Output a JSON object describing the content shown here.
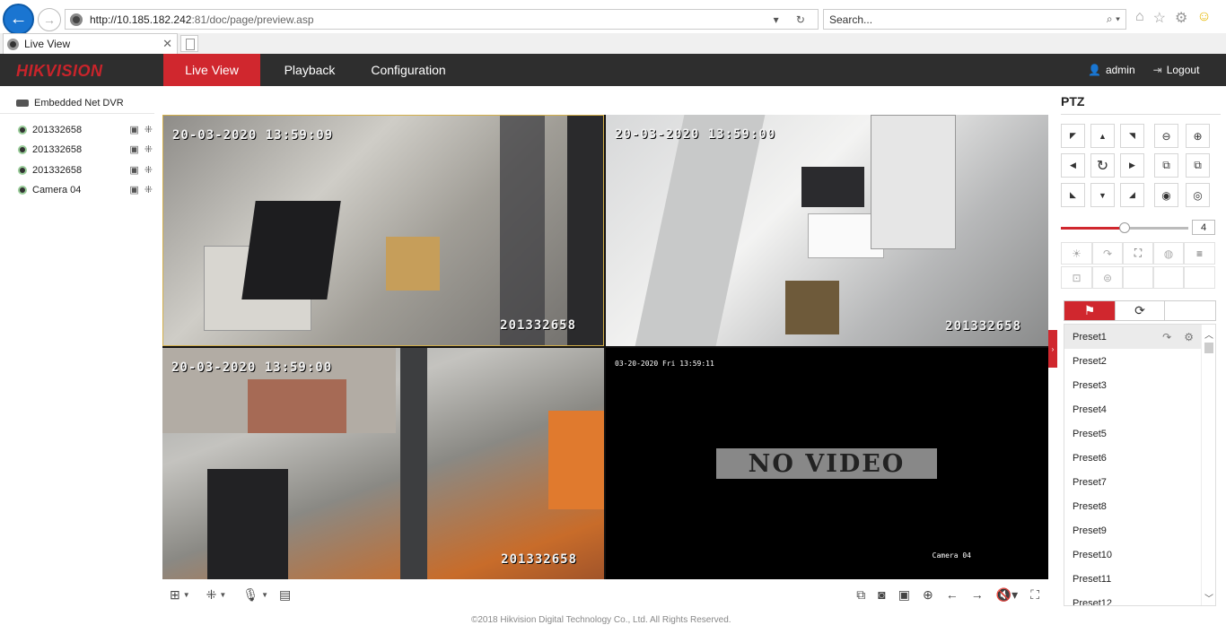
{
  "browser": {
    "url_host": "http://10.185.182.242",
    "url_path": ":81/doc/page/preview.asp",
    "search_placeholder": "Search...",
    "tab_title": "Live View"
  },
  "header": {
    "logo": "HIKVISION",
    "nav": [
      "Live View",
      "Playback",
      "Configuration"
    ],
    "user": "admin",
    "logout": "Logout"
  },
  "tree": {
    "root": "Embedded Net DVR",
    "cameras": [
      "201332658",
      "201332658",
      "201332658",
      "Camera 04"
    ]
  },
  "video": {
    "timestamps": [
      "20-03-2020 13:59:09",
      "20-03-2020 13:59:00",
      "20-03-2020 13:59:00",
      "03-20-2020 Fri 13:59:11"
    ],
    "cam_names": [
      "201332658",
      "201332658",
      "201332658",
      "Camera 04"
    ],
    "no_video": "NO VIDEO"
  },
  "footer": "©2018 Hikvision Digital Technology Co., Ltd. All Rights Reserved.",
  "ptz": {
    "title": "PTZ",
    "speed": "4",
    "speed_level": 4,
    "speed_max": 7,
    "presets": [
      "Preset1",
      "Preset2",
      "Preset3",
      "Preset4",
      "Preset5",
      "Preset6",
      "Preset7",
      "Preset8",
      "Preset9",
      "Preset10",
      "Preset11",
      "Preset12"
    ]
  },
  "colors": {
    "accent": "#d0272e",
    "header_bg": "#2e2e2e"
  }
}
